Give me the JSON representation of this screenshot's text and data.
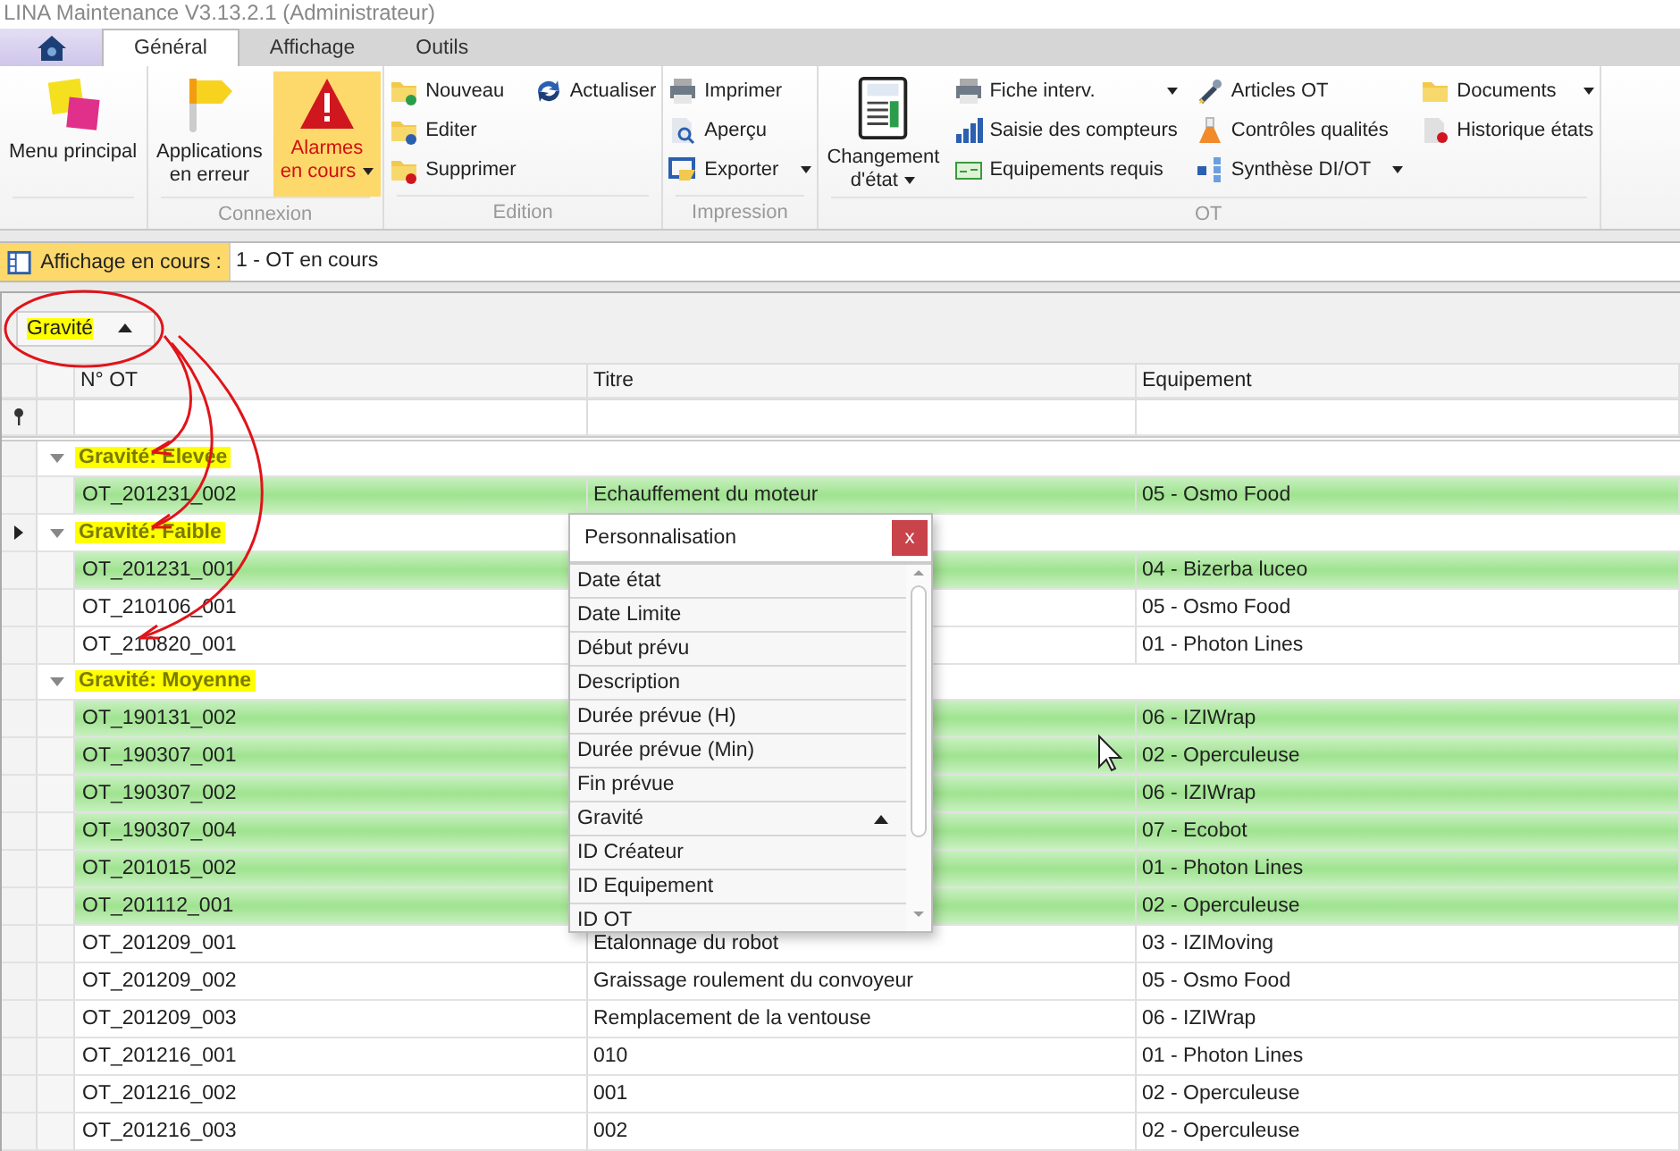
{
  "window": {
    "title": "LINA Maintenance  V3.13.2.1  (Administrateur)"
  },
  "tabs": [
    {
      "label": "Général",
      "selected": true
    },
    {
      "label": "Affichage",
      "selected": false
    },
    {
      "label": "Outils",
      "selected": false
    }
  ],
  "ribbon": {
    "groups": [
      {
        "items": [
          {
            "label": "Menu principal",
            "kind": "large",
            "dropdown": false,
            "highlighted": false
          }
        ]
      },
      {
        "label": "Connexion",
        "items": [
          {
            "label": "Applications\nen erreur",
            "kind": "large",
            "dropdown": false,
            "highlighted": false
          },
          {
            "label": "Alarmes\nen cours",
            "kind": "large",
            "dropdown": true,
            "highlighted": true
          }
        ]
      },
      {
        "label": "Edition",
        "items": [
          {
            "label": "Nouveau",
            "kind": "small",
            "dropdown": false,
            "highlighted": false
          },
          {
            "label": "Editer",
            "kind": "small",
            "dropdown": false,
            "highlighted": false
          },
          {
            "label": "Supprimer",
            "kind": "small",
            "dropdown": false,
            "highlighted": false
          },
          {
            "label": "Actualiser",
            "kind": "small",
            "dropdown": false,
            "highlighted": false
          }
        ]
      },
      {
        "label": "Impression",
        "items": [
          {
            "label": "Imprimer",
            "kind": "small",
            "dropdown": false,
            "highlighted": false
          },
          {
            "label": "Aperçu",
            "kind": "small",
            "dropdown": false,
            "highlighted": false
          },
          {
            "label": "Exporter",
            "kind": "small",
            "dropdown": true,
            "highlighted": false
          }
        ]
      },
      {
        "label": "OT",
        "items": [
          {
            "label": "Changement\nd'état",
            "kind": "large",
            "dropdown": true,
            "highlighted": false
          },
          {
            "label": "Fiche interv.",
            "kind": "small",
            "dropdown": true,
            "highlighted": false
          },
          {
            "label": "Saisie des compteurs",
            "kind": "small",
            "dropdown": false,
            "highlighted": false
          },
          {
            "label": "Equipements requis",
            "kind": "small",
            "dropdown": false,
            "highlighted": false
          },
          {
            "label": "Articles OT",
            "kind": "small",
            "dropdown": false,
            "highlighted": false
          },
          {
            "label": "Contrôles qualités",
            "kind": "small",
            "dropdown": false,
            "highlighted": false
          },
          {
            "label": "Synthèse DI/OT",
            "kind": "small",
            "dropdown": true,
            "highlighted": false
          },
          {
            "label": "Documents",
            "kind": "small",
            "dropdown": true,
            "highlighted": false
          },
          {
            "label": "Historique états",
            "kind": "small",
            "dropdown": false,
            "highlighted": false
          }
        ]
      }
    ]
  },
  "view_bar": {
    "label": "Affichage en cours :",
    "value": "1 - OT en cours"
  },
  "grid": {
    "group_by": {
      "label": "Gravité",
      "sorted": true
    },
    "columns": [
      "N° OT",
      "Titre",
      "Equipement"
    ],
    "groups": [
      {
        "label": "Gravité: Elevée",
        "expanded": true,
        "focused": false,
        "rows": [
          {
            "ot": "OT_201231_002",
            "title": "Echauffement du moteur",
            "equipment": "05 - Osmo Food",
            "highlighted": true
          }
        ]
      },
      {
        "label": "Gravité: Faible",
        "expanded": true,
        "focused": true,
        "rows": [
          {
            "ot": "OT_201231_001",
            "equipment": "04 - Bizerba luceo",
            "highlighted": true
          },
          {
            "ot": "OT_210106_001",
            "equipment": "05 - Osmo Food",
            "highlighted": false
          },
          {
            "ot": "OT_210820_001",
            "equipment": "01 - Photon Lines",
            "highlighted": false
          }
        ]
      },
      {
        "label": "Gravité: Moyenne",
        "expanded": true,
        "focused": false,
        "rows": [
          {
            "ot": "OT_190131_002",
            "equipment": "06 - IZIWrap",
            "highlighted": true
          },
          {
            "ot": "OT_190307_001",
            "equipment": "02 - Operculeuse",
            "highlighted": true
          },
          {
            "ot": "OT_190307_002",
            "equipment": "06 - IZIWrap",
            "highlighted": true
          },
          {
            "ot": "OT_190307_004",
            "equipment": "07 - Ecobot",
            "highlighted": true
          },
          {
            "ot": "OT_201015_002",
            "equipment": "01 - Photon Lines",
            "highlighted": true
          },
          {
            "ot": "OT_201112_001",
            "equipment": "02 - Operculeuse",
            "highlighted": true
          },
          {
            "ot": "OT_201209_001",
            "title": "Etalonnage du robot",
            "equipment": "03 - IZIMoving",
            "highlighted": false
          },
          {
            "ot": "OT_201209_002",
            "title": "Graissage roulement du convoyeur",
            "equipment": "05 - Osmo Food",
            "highlighted": false
          },
          {
            "ot": "OT_201209_003",
            "title": "Remplacement de la ventouse",
            "equipment": "06 - IZIWrap",
            "highlighted": false
          },
          {
            "ot": "OT_201216_001",
            "title": "010",
            "equipment": "01 - Photon Lines",
            "highlighted": false
          },
          {
            "ot": "OT_201216_002",
            "title": "001",
            "equipment": "02 - Operculeuse",
            "highlighted": false
          },
          {
            "ot": "OT_201216_003",
            "title": "002",
            "equipment": "02 - Operculeuse",
            "highlighted": false
          }
        ]
      }
    ]
  },
  "popup": {
    "title": "Personnalisation",
    "close": "x",
    "items": [
      {
        "label": "Date état",
        "sorted": false
      },
      {
        "label": "Date Limite",
        "sorted": false
      },
      {
        "label": "Début prévu",
        "sorted": false
      },
      {
        "label": "Description",
        "sorted": false
      },
      {
        "label": "Durée prévue (H)",
        "sorted": false
      },
      {
        "label": "Durée prévue (Min)",
        "sorted": false
      },
      {
        "label": "Fin prévue",
        "sorted": false
      },
      {
        "label": "Gravité",
        "sorted": true
      },
      {
        "label": "ID Créateur",
        "sorted": false
      },
      {
        "label": "ID Equipement",
        "sorted": false
      },
      {
        "label": "ID OT",
        "sorted": false
      }
    ]
  }
}
